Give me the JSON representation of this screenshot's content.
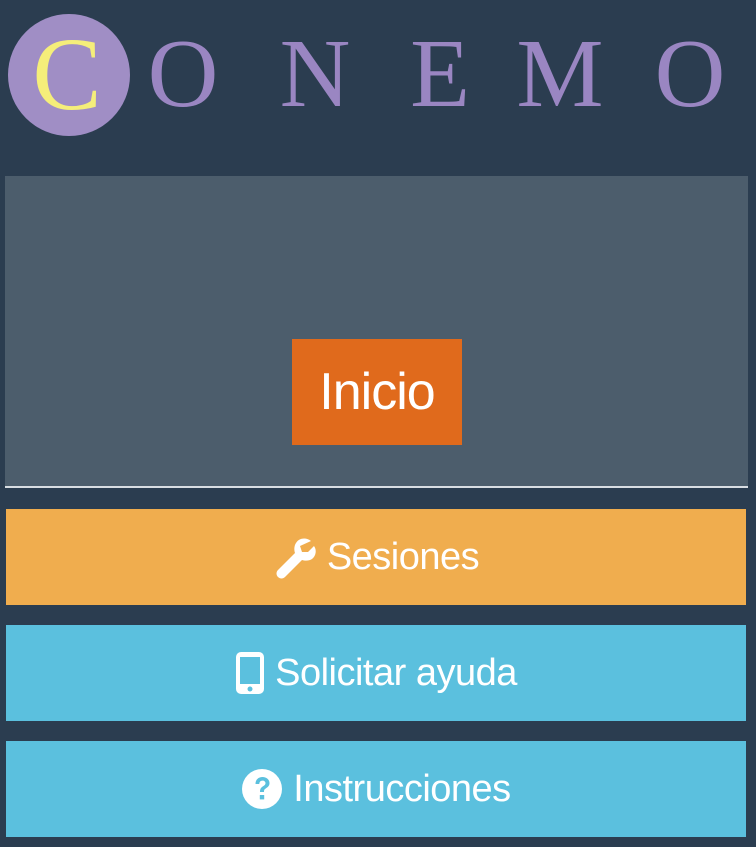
{
  "logo": {
    "first_letter": "C",
    "letters": [
      "O",
      "N",
      "E",
      "M",
      "O"
    ],
    "circle_color": "#a08ec5",
    "first_letter_color": "#f5ee7a",
    "letter_color": "#9a86c2"
  },
  "hero": {
    "button_label": "Inicio",
    "background": "#4c5d6c",
    "button_color": "#e06a1c"
  },
  "menu": {
    "sesiones": {
      "label": "Sesiones",
      "icon": "wrench-icon",
      "color": "#f0ad4e"
    },
    "ayuda": {
      "label": "Solicitar ayuda",
      "icon": "phone-icon",
      "color": "#5bc0de"
    },
    "instrucciones": {
      "label": "Instrucciones",
      "icon": "question-circle-icon",
      "color": "#5bc0de"
    }
  }
}
